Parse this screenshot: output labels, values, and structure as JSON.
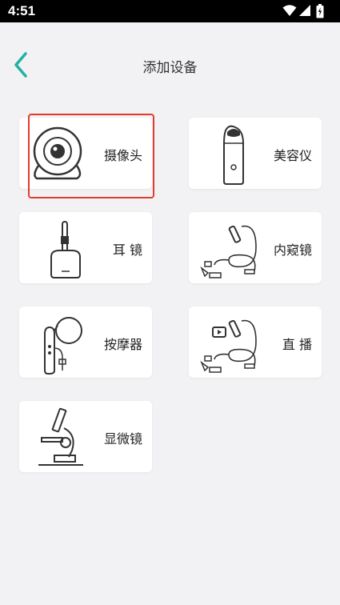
{
  "status_bar": {
    "time": "4:51",
    "icons": [
      "wifi-icon",
      "signal-icon",
      "battery-icon"
    ]
  },
  "header": {
    "title": "添加设备",
    "back_icon": "chevron-left-icon",
    "accent_color": "#20b2a0"
  },
  "devices": [
    {
      "label": "摄像头",
      "icon": "camera-icon",
      "selected": true
    },
    {
      "label": "美容仪",
      "icon": "beauty-device-icon",
      "selected": false
    },
    {
      "label": "耳 镜",
      "icon": "otoscope-icon",
      "selected": false
    },
    {
      "label": "内窥镜",
      "icon": "endoscope-icon",
      "selected": false
    },
    {
      "label": "按摩器",
      "icon": "massager-icon",
      "selected": false
    },
    {
      "label": "直 播",
      "icon": "live-stream-icon",
      "selected": false
    },
    {
      "label": "显微镜",
      "icon": "microscope-icon",
      "selected": false
    }
  ],
  "selection_color": "#e33b2d"
}
